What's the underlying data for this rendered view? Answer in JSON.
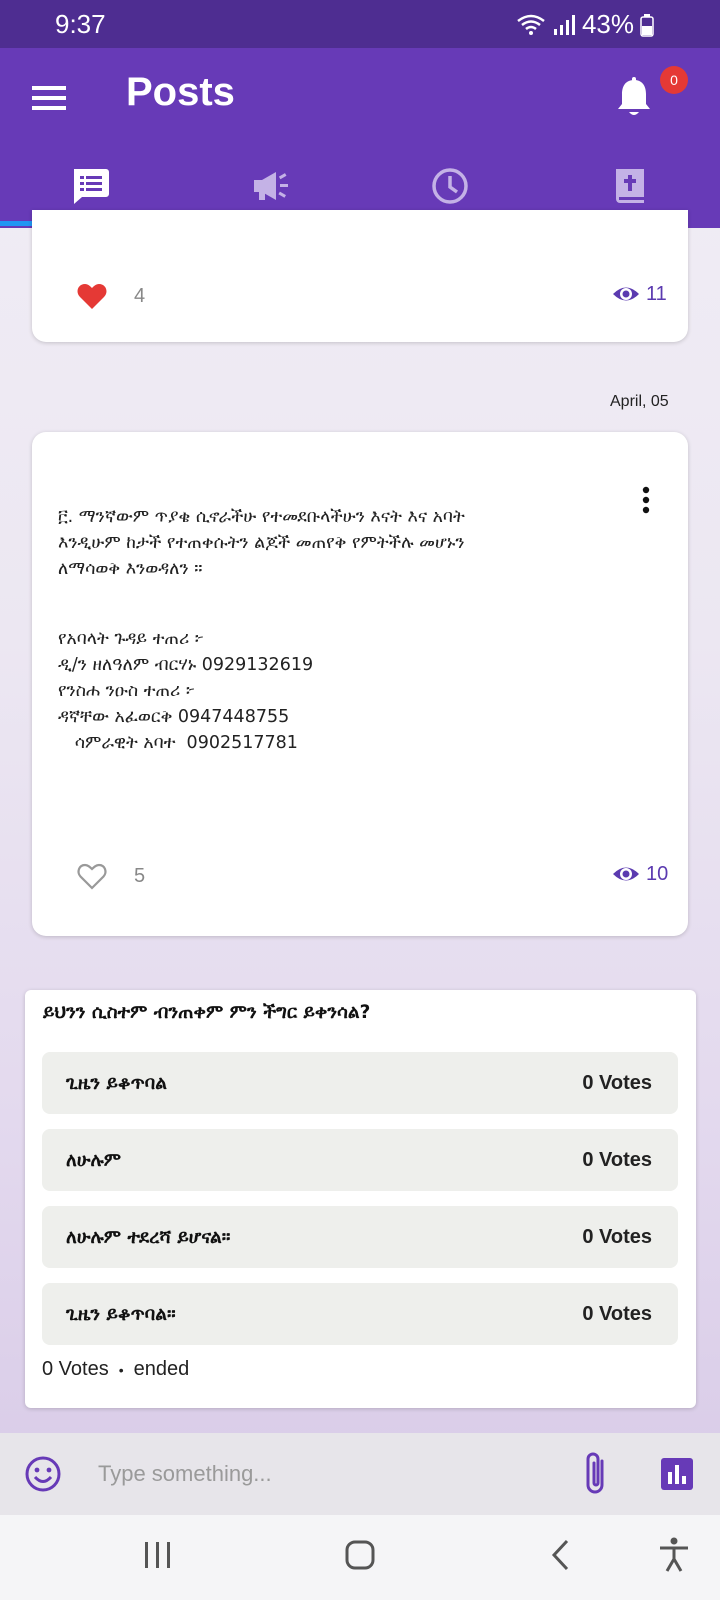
{
  "status_bar": {
    "time": "9:37",
    "battery": "43%"
  },
  "app_bar": {
    "title": "Posts",
    "notification_count": "0",
    "tabs": [
      {
        "icon": "feed-icon",
        "active": true
      },
      {
        "icon": "megaphone-icon",
        "active": false
      },
      {
        "icon": "clock-icon",
        "active": false
      },
      {
        "icon": "bible-book-icon",
        "active": false
      }
    ]
  },
  "posts": [
    {
      "likes": "4",
      "liked": true,
      "views": "11"
    },
    {
      "date": "April, 05",
      "body": "፫. ማንኛውም ጥያቄ ሲኖራችሁ የተመደቡላችሁን እናት እና አባት\nእንዲሁም ከታች የተጠቀሱትን ልጆች መጠየቅ የምትችሉ መሆኑን\nለማሳወቅ እንወዳለን ።",
      "contacts": "የአባላት ጉዳይ ተጠሪ ፦\nዲ/ን ዘለዓለም ብርሃኑ 0929132619\nየንስሐ ንዑስ ተጠሪ ፦\nዳኛቸው አፈወርቅ 0947448755\n   ሳምራዊት አባተ  0902517781",
      "likes": "5",
      "liked": false,
      "views": "10"
    }
  ],
  "poll": {
    "question": "ይህንን ሲስተም ብንጠቀም ምን ችግር ይቀንሳል?",
    "options": [
      {
        "label": "ጊዜን ይቆጥባል",
        "votes": "0 Votes"
      },
      {
        "label": "ለሁሉም",
        "votes": "0 Votes"
      },
      {
        "label": "ለሁሉም ተደረሻ ይሆናል።",
        "votes": "0 Votes"
      },
      {
        "label": "ጊዜን ይቆጥባል።",
        "votes": "0 Votes"
      }
    ],
    "total_votes": "0 Votes",
    "separator": "•",
    "state": "ended"
  },
  "composer": {
    "placeholder": "Type something..."
  },
  "colors": {
    "primary": "#673ab7",
    "status_bar": "#4e2d91",
    "accent_indicator": "#2196f3",
    "like_red": "#e53935",
    "views_purple": "#5b3ab0"
  }
}
